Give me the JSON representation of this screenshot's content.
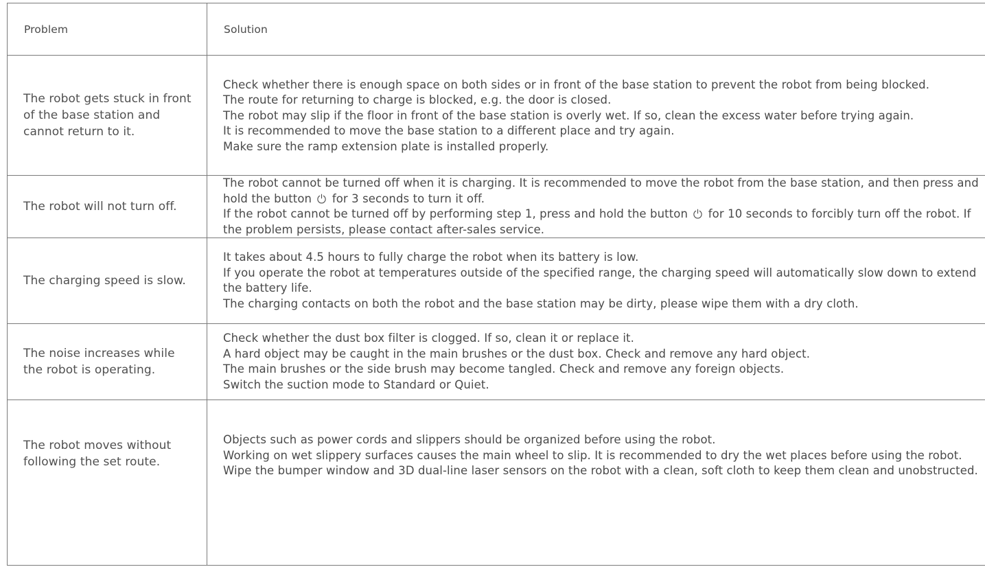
{
  "table": {
    "headers": {
      "problem": "Problem",
      "solution": "Solution"
    },
    "rows": [
      {
        "problem": "The robot gets stuck in front of the base station and cannot return to it.",
        "solutions": [
          "Check whether there is enough space on both sides or in front of the base station to prevent the robot from being blocked.",
          "The route for returning to charge is blocked, e.g. the door is closed.",
          "The robot may slip if the floor in front of the base station is overly wet. If so, clean the excess water before trying again.",
          "It is recommended to move the base station to a different place and try again.",
          "Make sure the ramp extension plate is installed properly."
        ]
      },
      {
        "problem": "The robot will not turn off.",
        "solutions_with_icon": [
          {
            "before": "The robot cannot be turned off when it is charging. It is recommended to move the robot from the base station, and then press and hold the button",
            "icon": "power-icon",
            "after": "for 3 seconds to turn it off."
          },
          {
            "before": "If the robot cannot be turned off by performing step 1, press and hold the button",
            "icon": "power-icon",
            "after": "for 10 seconds to forcibly turn off the robot. If the problem persists, please contact after-sales service."
          }
        ]
      },
      {
        "problem": "The charging speed is slow.",
        "solutions": [
          "It takes about 4.5 hours to fully charge the robot when its battery is low.",
          "If you operate the robot at temperatures outside of the specified range, the charging speed will automatically slow down to extend the battery life.",
          "The charging contacts on both the robot and the base station may be dirty, please wipe them with a dry cloth."
        ]
      },
      {
        "problem": "The noise increases while the robot is operating.",
        "solutions": [
          "Check whether the dust box filter is clogged. If so, clean it or replace it.",
          "A hard object may be caught in the main brushes or the dust box. Check and remove any hard object.",
          "The main brushes or the side brush may become tangled. Check and remove any foreign objects.",
          "Switch the suction mode to Standard or Quiet."
        ]
      },
      {
        "problem": "The robot moves without following the set route.",
        "solutions": [
          "Objects such as power cords and slippers should be organized before using the robot.",
          "Working on wet slippery surfaces causes the main wheel to slip. It is recommended to dry the wet places before using the robot.",
          "Wipe the bumper window and 3D dual-line laser sensors on the robot with a clean, soft cloth to keep them clean and unobstructed."
        ]
      }
    ]
  }
}
